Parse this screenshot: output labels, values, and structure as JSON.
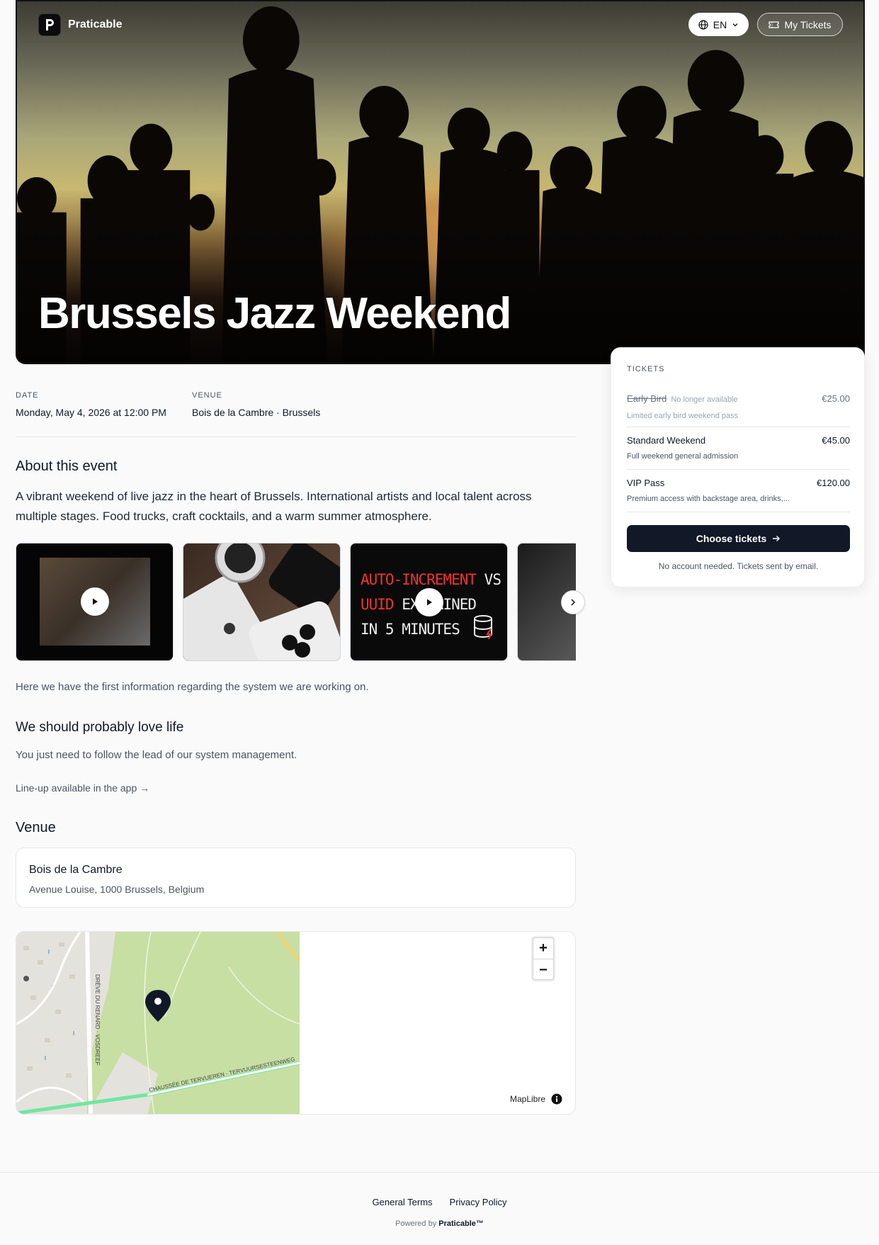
{
  "header": {
    "brand": "Praticable",
    "language": "EN",
    "my_tickets": "My Tickets"
  },
  "event": {
    "title": "Brussels Jazz Weekend",
    "date_label": "DATE",
    "date_value": "Monday, May 4, 2026 at 12:00 PM",
    "venue_label": "VENUE",
    "venue_value": "Bois de la Cambre · Brussels"
  },
  "about": {
    "heading": "About this event",
    "text": "A vibrant weekend of live jazz in the heart of Brussels. International artists and local talent across multiple stages. Food trucks, craft cocktails, and a warm summer atmosphere."
  },
  "carousel": {
    "card3_lines": [
      "AUTO-INCREMENT",
      "VS",
      "UUID",
      "EXPLAINED",
      "IN 5 MINUTES"
    ]
  },
  "info_text": "Here we have the first information regarding the system we are working on.",
  "love": {
    "heading": "We should probably love life",
    "text": "You just need to follow the lead of our system management."
  },
  "lineup_link": "Line-up available in the app →",
  "venue": {
    "heading": "Venue",
    "name": "Bois de la Cambre",
    "address": "Avenue Louise, 1000 Brussels, Belgium"
  },
  "map": {
    "road_1": "DRÈVE DU RENARD · VOSDREEF",
    "road_2": "CHAUSSÉE DE TERVUEREN · TERVUURSESTEENWEG",
    "zoom_in": "+",
    "zoom_out": "−",
    "attribution": "MapLibre"
  },
  "tickets": {
    "title": "TICKETS",
    "items": [
      {
        "name": "Early Bird",
        "status": "No longer available",
        "price": "€25.00",
        "desc": "Limited early bird weekend pass"
      },
      {
        "name": "Standard Weekend",
        "price": "€45.00",
        "desc": "Full weekend general admission"
      },
      {
        "name": "VIP Pass",
        "price": "€120.00",
        "desc": "Premium access with backstage area, drinks,..."
      }
    ],
    "cta": "Choose tickets",
    "note": "No account needed. Tickets sent by email."
  },
  "footer": {
    "terms": "General Terms",
    "privacy": "Privacy Policy",
    "powered_prefix": "Powered by",
    "powered_brand": "Praticable™"
  },
  "colors": {
    "primary": "#111827",
    "map_park": "#c7dfa3",
    "map_road": "#6ee7a0"
  }
}
